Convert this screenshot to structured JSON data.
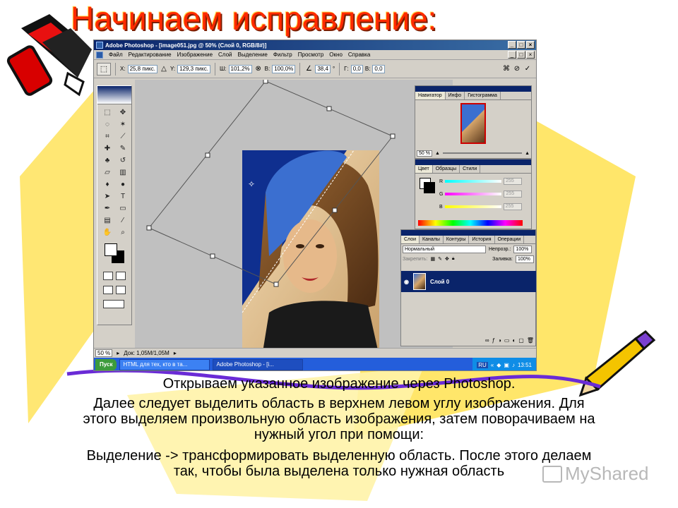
{
  "slide": {
    "title": "Начинаем исправление:",
    "captions": [
      "Открываем указанное изображение через Photoshop.",
      "Далее следует выделить область в верхнем левом углу изображения. Для",
      "этого выделяем произвольную область изображения, затем поворачиваем на",
      "нужный угол при помощи:",
      "Выделение -> трансформировать выделенную область. После этого делаем",
      "так, чтобы была выделена только нужная область"
    ],
    "watermark": "MyShared"
  },
  "photoshop": {
    "window_title": "Adobe Photoshop - [image051.jpg @ 50% (Слой 0, RGB/8#)]",
    "window_buttons": [
      "_",
      "□",
      "×"
    ],
    "menu": [
      "Файл",
      "Редактирование",
      "Изображение",
      "Слой",
      "Выделение",
      "Фильтр",
      "Просмотр",
      "Окно",
      "Справка"
    ],
    "options": {
      "x_label": "X:",
      "x_value": "25,8 пикс.",
      "y_label": "Y:",
      "y_value": "129,3 пикс.",
      "w_label": "Ш:",
      "w_value": "101,2%",
      "h_label": "В:",
      "h_value": "100,0%",
      "angle_value": "38,4",
      "angle_unit": "°",
      "g_label": "Г:",
      "g_value": "0,0",
      "v_label": "В:",
      "v_value": "0,0"
    },
    "status": {
      "zoom": "50 %",
      "doc": "Док: 1,05M/1,05M"
    },
    "navigator": {
      "tabs": [
        "Навигатор",
        "Инфо",
        "Гистограмма"
      ],
      "zoom": "50 %"
    },
    "color": {
      "tabs": [
        "Цвет",
        "Образцы",
        "Стили"
      ],
      "channels": [
        {
          "label": "R",
          "value": "255",
          "from": "#00ffff",
          "to": "#ffffff"
        },
        {
          "label": "G",
          "value": "255",
          "from": "#ff00ff",
          "to": "#ffffff"
        },
        {
          "label": "B",
          "value": "255",
          "from": "#ffff00",
          "to": "#ffffff"
        }
      ]
    },
    "layers": {
      "tabs": [
        "Слои",
        "Каналы",
        "Контуры",
        "История",
        "Операции"
      ],
      "blend_mode": "Нормальный",
      "opacity_label": "Непрозр.:",
      "opacity": "100%",
      "lock_label": "Закрепить:",
      "fill_label": "Заливка:",
      "fill": "100%",
      "layer_name": "Слой 0"
    },
    "taskbar": {
      "start": "Пуск",
      "items": [
        "HTML для тех, кто в та...",
        "Adobe Photoshop - [i..."
      ],
      "lang": "RU",
      "clock": "13:51"
    },
    "colors": {
      "title_blue": "#0a246a",
      "taskbar_blue": "#245edb",
      "hair_blue": "#3b6fd0"
    }
  }
}
